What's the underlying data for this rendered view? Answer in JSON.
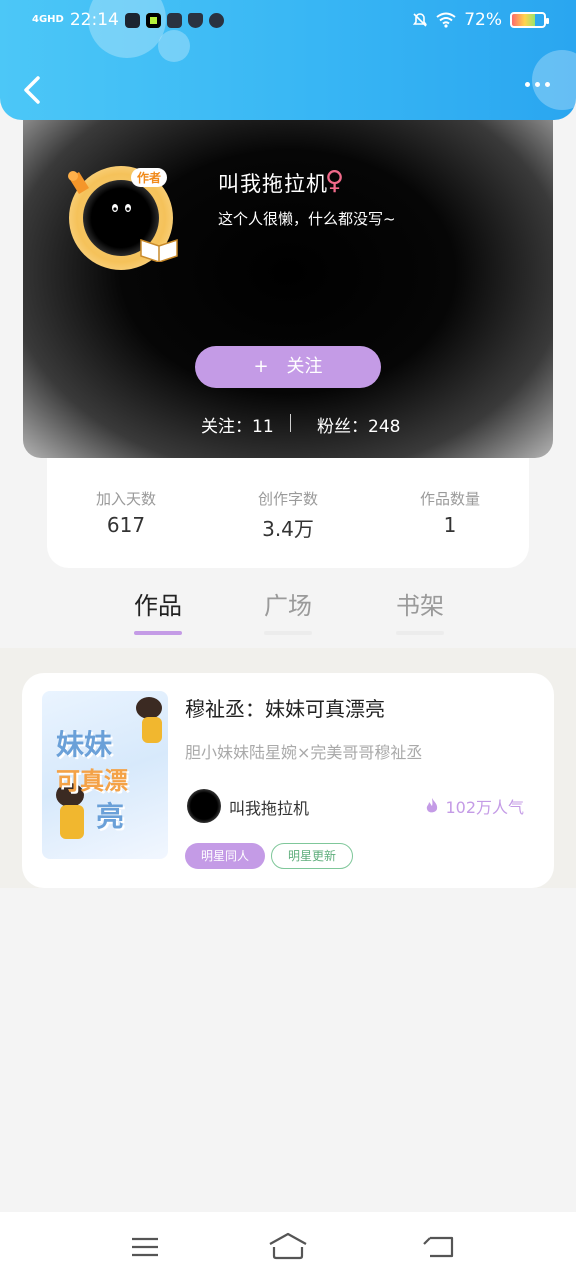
{
  "status_bar": {
    "network": "4GHD",
    "time": "22:14",
    "battery": "72%"
  },
  "profile": {
    "badge": "作者",
    "name": "叫我拖拉机",
    "gender_symbol": "♀",
    "bio": "这个人很懒，什么都没写~",
    "follow_label": "关注",
    "follow_plus": "+",
    "following": "关注：11",
    "followers": "粉丝：248"
  },
  "stats": [
    {
      "label": "加入天数",
      "value": "617"
    },
    {
      "label": "创作字数",
      "value": "3.4万"
    },
    {
      "label": "作品数量",
      "value": "1"
    }
  ],
  "tabs": [
    {
      "label": "作品",
      "active": true
    },
    {
      "label": "广场",
      "active": false
    },
    {
      "label": "书架",
      "active": false
    }
  ],
  "works": [
    {
      "title": "穆祉丞：妹妹可真漂亮",
      "description": "胆小妹妹陆星婉×完美哥哥穆祉丞",
      "author": "叫我拖拉机",
      "popularity": "102万人气",
      "tags": [
        "明星同人",
        "明星更新"
      ],
      "cover_text": [
        "妹妹",
        "可真漂",
        "亮"
      ]
    }
  ],
  "colors": {
    "header_blue": "#38b6f4",
    "accent_purple": "#c49be6",
    "tag_green": "#5fae7c"
  }
}
